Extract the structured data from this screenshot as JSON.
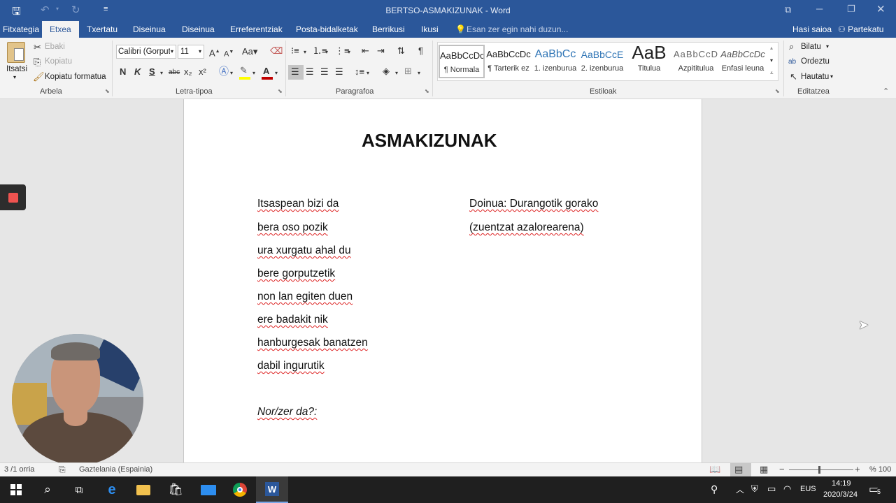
{
  "window": {
    "title": "BERTSO-ASMAKIZUNAK - Word"
  },
  "tabs": [
    "Fitxategia",
    "Etxea",
    "Txertatu",
    "Diseinua",
    "Diseinua",
    "Erreferentziak",
    "Posta-bidalketak",
    "Berrikusi",
    "Ikusi"
  ],
  "tell_me": "Esan zer egin nahi duzun...",
  "account": {
    "signin": "Hasi saioa",
    "share": "Partekatu"
  },
  "clipboard": {
    "paste": "Itsatsi",
    "cut": "Ebaki",
    "copy": "Kopiatu",
    "format_painter": "Kopiatu formatua",
    "label": "Arbela"
  },
  "font": {
    "name": "Calibri (Gorput",
    "size": "11",
    "bold": "N",
    "italic": "K",
    "underline": "S",
    "strike": "abc",
    "sub": "x₂",
    "sup": "x²",
    "label": "Letra-tipoa"
  },
  "paragraph": {
    "label": "Paragrafoa"
  },
  "styles": {
    "label": "Estiloak",
    "items": [
      {
        "sample": "AaBbCcDc",
        "name": "¶ Normala"
      },
      {
        "sample": "AaBbCcDc",
        "name": "¶ Tarterik ez"
      },
      {
        "sample": "AaBbCc",
        "name": "1. izenburua"
      },
      {
        "sample": "AaBbCcE",
        "name": "2. izenburua"
      },
      {
        "sample": "AaB",
        "name": "Titulua"
      },
      {
        "sample": "AaBbCcD",
        "name": "Azpititulua"
      },
      {
        "sample": "AaBbCcDc",
        "name": "Enfasi leuna"
      }
    ]
  },
  "editing": {
    "find": "Bilatu",
    "replace": "Ordeztu",
    "select": "Hautatu",
    "label": "Editatzea"
  },
  "document": {
    "heading": "ASMAKIZUNAK",
    "left_lines": [
      "Itsaspean bizi da",
      "bera oso pozik",
      "ura xurgatu ahal du",
      "bere gorputzetik",
      "non lan egiten duen",
      "ere badakit nik",
      "hanburgesak banatzen",
      "dabil ingurutik"
    ],
    "question": "Nor/zer da?:",
    "right_lines": [
      "Doinua: Durangotik gorako",
      "(zuentzat azalorearena)"
    ]
  },
  "status": {
    "page": "3 /1 orria",
    "language": "Gaztelania (Espainia)",
    "zoom": "% 100"
  },
  "taskbar": {
    "lang": "EUS",
    "time": "14:19",
    "date": "2020/3/24",
    "notif": "5"
  },
  "colors": {
    "word_blue": "#2b579a",
    "font_red": "#c00000",
    "highlight": "#ffff00"
  }
}
